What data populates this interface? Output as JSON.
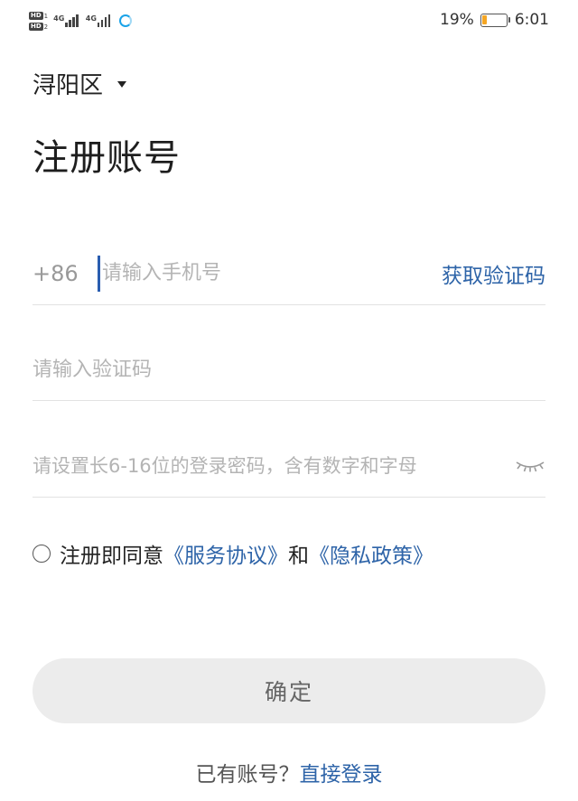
{
  "status_bar": {
    "hd1": "HD",
    "hd1_num": "1",
    "hd2": "HD",
    "hd2_num": "2",
    "signal1": "4G",
    "signal2": "4G",
    "battery_percent": "19%",
    "battery_level": 0.19,
    "battery_color": "#f5a623",
    "time": "6:01",
    "icons": [
      "hd-icon",
      "signal-icon",
      "signal-icon",
      "data-sync-icon",
      "battery-icon"
    ]
  },
  "region": {
    "name": "浔阳区",
    "icon": "caret-down-icon"
  },
  "title": "注册账号",
  "form": {
    "country_code": "+86",
    "phone_placeholder": "请输入手机号",
    "phone_value": "",
    "get_code": "获取验证码",
    "code_placeholder": "请输入验证码",
    "code_value": "",
    "password_placeholder": "请设置长6-16位的登录密码，含有数字和字母",
    "password_value": "",
    "eye_icon": "eye-closed-icon"
  },
  "agreement": {
    "prefix": "注册即同意",
    "terms": "《服务协议》",
    "joiner": "和",
    "privacy": "《隐私政策》",
    "checked": false
  },
  "confirm_label": "确定",
  "login": {
    "prompt": "已有账号？",
    "link": "直接登录"
  },
  "colors": {
    "link": "#2e64a8",
    "cursor": "#2a5db0",
    "button_bg": "#ececec",
    "placeholder": "#b4b4b4"
  }
}
